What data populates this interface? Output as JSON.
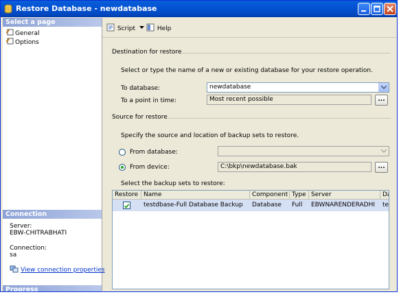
{
  "window": {
    "title": "Restore Database - newdatabase"
  },
  "left_panel": {
    "select_page_header": "Select a page",
    "pages": [
      {
        "label": "General",
        "icon": "page-icon"
      },
      {
        "label": "Options",
        "icon": "page-icon"
      }
    ],
    "connection_header": "Connection",
    "server_label": "Server:",
    "server_value": "EBW-CHITRABHATI",
    "connection_label": "Connection:",
    "connection_value": "sa",
    "view_connection_link": "View connection properties",
    "progress_header": "Progress"
  },
  "toolbar": {
    "script_label": "Script",
    "help_label": "Help"
  },
  "destination": {
    "group_title": "Destination for restore",
    "description": "Select or type the name of a new or existing database for your restore operation.",
    "to_database_label": "To database:",
    "to_database_value": "newdatabase",
    "point_in_time_label": "To a point in time:",
    "point_in_time_value": "Most recent possible"
  },
  "source": {
    "group_title": "Source for restore",
    "description": "Specify the source and location of backup sets to restore.",
    "from_database_label": "From database:",
    "from_database_value": "",
    "from_device_label": "From device:",
    "from_device_value": "C:\\bkp\\newdatabase.bak",
    "selected_option": "From device"
  },
  "backup_sets": {
    "label": "Select the backup sets to restore:",
    "columns": [
      "Restore",
      "Name",
      "Component",
      "Type",
      "Server",
      "Da"
    ],
    "rows": [
      {
        "restore": true,
        "name": "testdbase-Full Database Backup",
        "component": "Database",
        "type": "Full",
        "server": "EBWNARENDERADHI",
        "database": "te"
      }
    ]
  },
  "ellipsis_label": "...",
  "colors": {
    "title_bar": "#0453d4",
    "section_header": "#8ca2d6",
    "selection": "#d6e0f5",
    "window_bg": "#ece9d8"
  }
}
